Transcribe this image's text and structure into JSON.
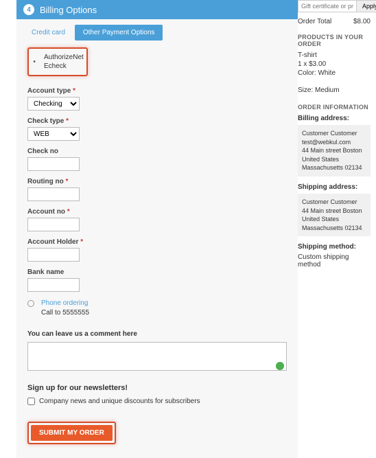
{
  "header": {
    "step": "4",
    "title": "Billing Options"
  },
  "tabs": {
    "credit": "Credit card",
    "other": "Other Payment Options"
  },
  "radio": {
    "line1": "AuthorizeNet",
    "line2": "Echeck"
  },
  "fields": {
    "account_type": {
      "label": "Account type",
      "value": "Checking"
    },
    "check_type": {
      "label": "Check type",
      "value": "WEB"
    },
    "check_no": {
      "label": "Check no"
    },
    "routing_no": {
      "label": "Routing no"
    },
    "account_no": {
      "label": "Account no"
    },
    "account_holder": {
      "label": "Account Holder"
    },
    "bank_name": {
      "label": "Bank name"
    }
  },
  "phone": {
    "title": "Phone ordering",
    "sub": "Call to 5555555"
  },
  "comment": {
    "label": "You can leave us a comment here"
  },
  "newsletter": {
    "heading": "Sign up for our newsletters!",
    "opt": "Company news and unique discounts for subscribers"
  },
  "submit": "SUBMIT MY ORDER",
  "side": {
    "promo_placeholder": "Gift certificate or promo code",
    "apply": "Apply",
    "order_total_label": "Order Total",
    "order_total": "$8.00",
    "products_h": "PRODUCTS IN YOUR ORDER",
    "prod_name": "T-shirt",
    "prod_qty": "1 x $3.00",
    "prod_color": "Color: White",
    "prod_size": "Size: Medium",
    "order_info_h": "ORDER INFORMATION",
    "billing_h": "Billing address:",
    "shipping_h": "Shipping address:",
    "addr": {
      "name": "Customer  Customer",
      "email": "test@webkul.com",
      "street": "44 Main street  Boston  United States",
      "region": "Massachusetts  02134"
    },
    "ship_method_h": "Shipping method:",
    "ship_method": "Custom shipping method"
  }
}
